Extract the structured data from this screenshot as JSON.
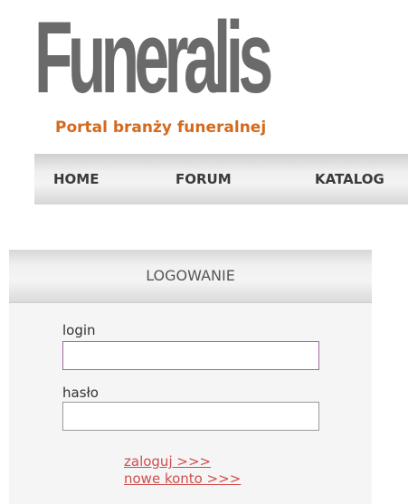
{
  "header": {
    "logo_text": "Funeralis",
    "tagline": "Portal branży funeralnej"
  },
  "nav": {
    "items": [
      {
        "label": "HOME"
      },
      {
        "label": "FORUM"
      },
      {
        "label": "KATALOG"
      }
    ]
  },
  "login": {
    "title": "LOGOWANIE",
    "login_label": "login",
    "login_value": "",
    "password_label": "hasło",
    "password_value": "",
    "submit_link": "zaloguj >>>",
    "register_link": "nowe konto >>>"
  },
  "colors": {
    "logo": "#6a6a6a",
    "tagline": "#d36a1f",
    "link": "#d14d4d"
  }
}
